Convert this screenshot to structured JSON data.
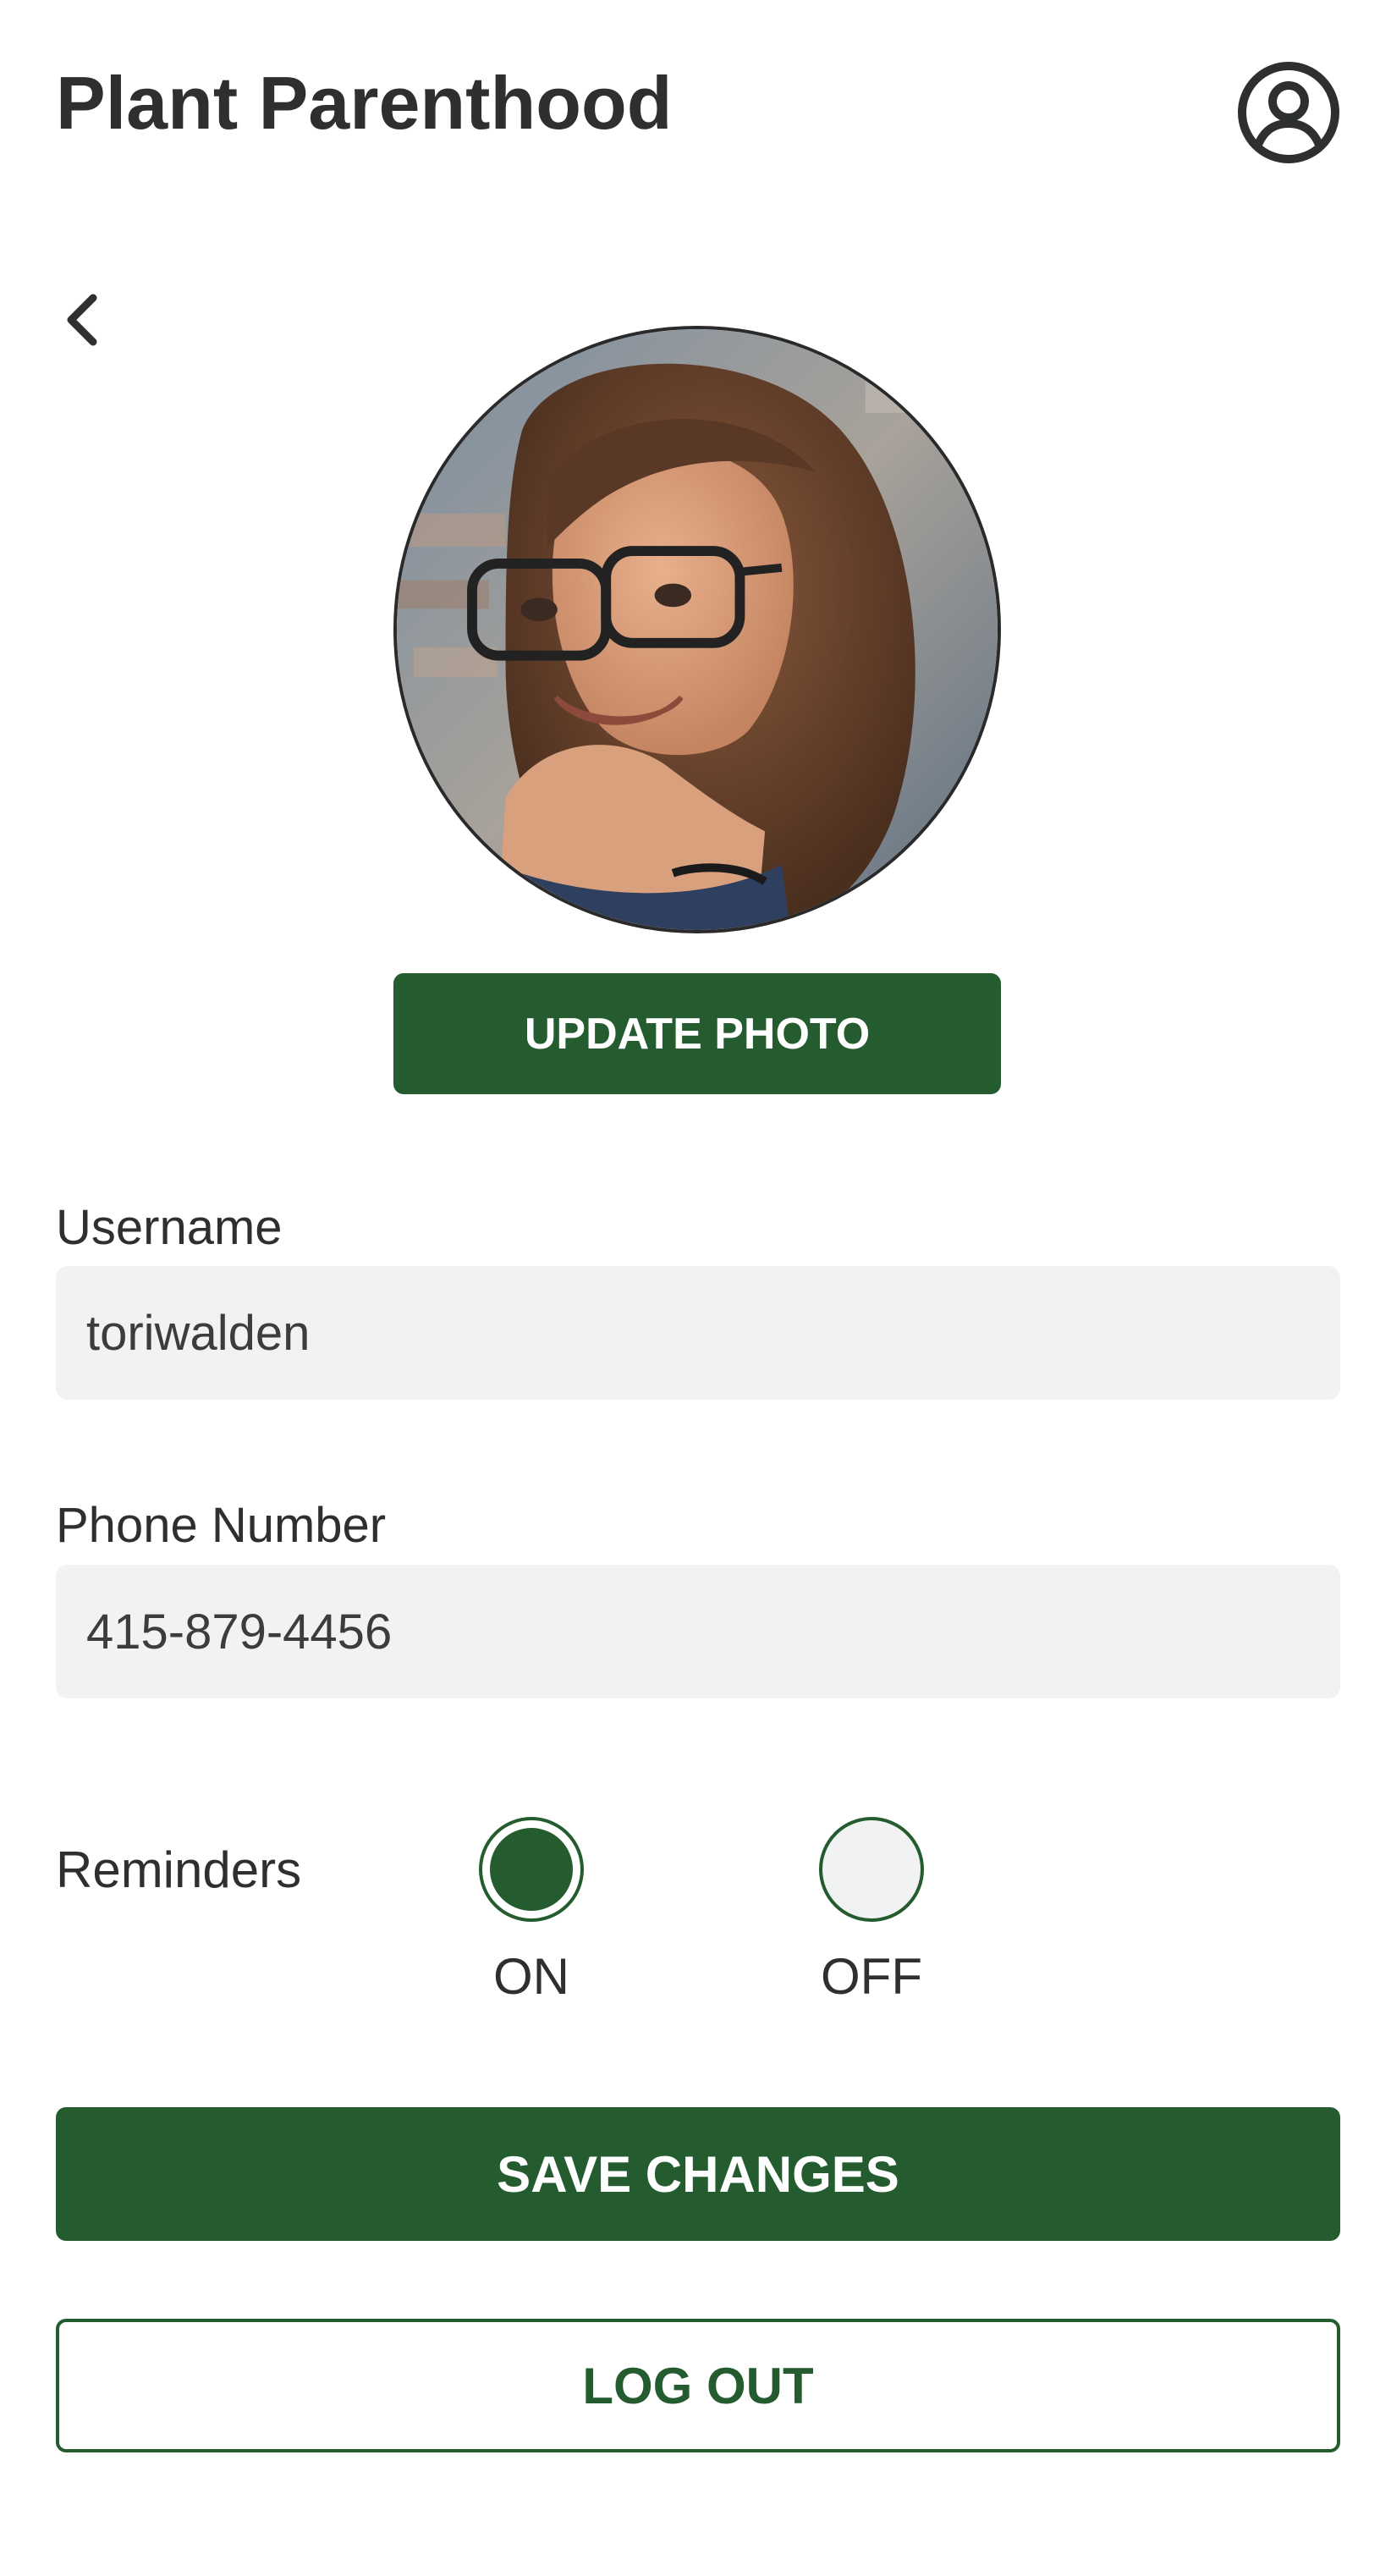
{
  "header": {
    "title": "Plant Parenthood",
    "profile_icon": "user-circle-icon"
  },
  "nav": {
    "back_icon": "chevron-left-icon"
  },
  "profile": {
    "photo_alt": "profile photo",
    "update_photo_label": "UPDATE PHOTO"
  },
  "form": {
    "username": {
      "label": "Username",
      "value": "toriwalden"
    },
    "phone": {
      "label": "Phone Number",
      "value": "415-879-4456"
    },
    "reminders": {
      "label": "Reminders",
      "options": [
        {
          "label": "ON",
          "selected": true
        },
        {
          "label": "OFF",
          "selected": false
        }
      ]
    }
  },
  "actions": {
    "save_label": "SAVE CHANGES",
    "logout_label": "LOG OUT"
  },
  "colors": {
    "brand_green": "#245c30",
    "text_dark": "#2d302f",
    "input_bg": "#f1f2f2"
  }
}
